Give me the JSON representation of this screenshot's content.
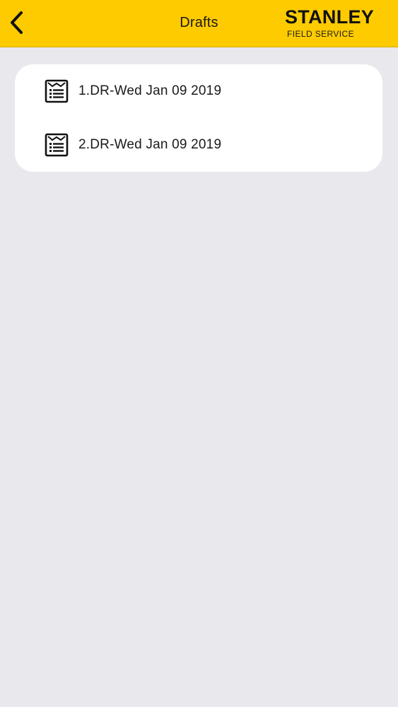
{
  "header": {
    "back_icon": "chevron-left-icon",
    "title": "Drafts",
    "logo": {
      "brand": "STANLEY",
      "subtitle": "FIELD SERVICE"
    },
    "background_color": "#fecb00"
  },
  "drafts": {
    "items": [
      {
        "label": "1.DR-Wed Jan 09 2019",
        "icon": "document-list-icon"
      },
      {
        "label": "2.DR-Wed Jan 09 2019",
        "icon": "document-list-icon"
      }
    ]
  }
}
